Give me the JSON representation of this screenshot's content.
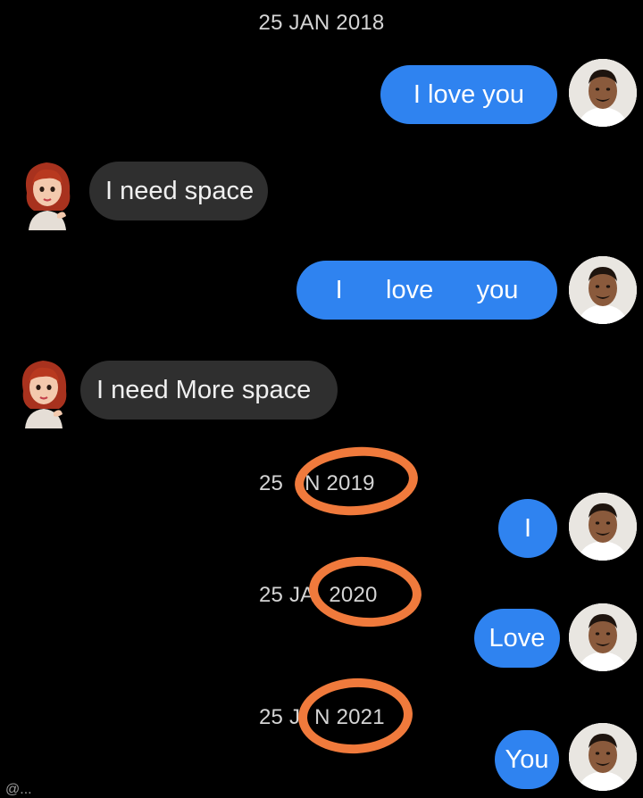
{
  "conversation": {
    "date_2018": "25 JAN 2018",
    "date_2019_prefix": "25",
    "date_2019_suffix": "N 2019",
    "date_2020_prefix": "25 JA",
    "date_2020_suffix": "2020",
    "date_2021_prefix": "25 J",
    "date_2021_suffix": "N 2021",
    "msg_1": "I love you",
    "msg_2": "I need space",
    "msg_3": "I      love      you",
    "msg_4": "I need More space",
    "msg_5": "I",
    "msg_6": "Love",
    "msg_7": "You"
  },
  "watermark": "@...",
  "colors": {
    "background": "#000000",
    "sent_bubble": "#2f83f0",
    "received_bubble": "#2f2f2f",
    "annotation_circle": "#f07a3c"
  }
}
